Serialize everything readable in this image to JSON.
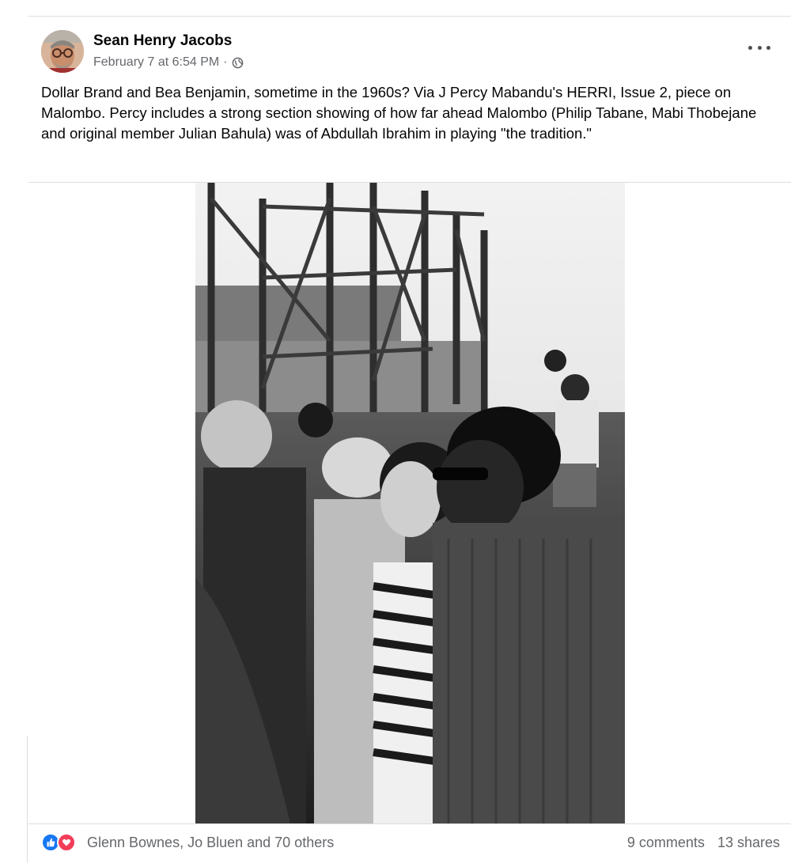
{
  "post": {
    "author": "Sean Henry Jacobs",
    "timestamp": "February 7 at 6:54 PM",
    "separator": "·",
    "privacy_icon": "globe-icon",
    "text": "Dollar Brand and Bea Benjamin, sometime in the 1960s? Via J Percy Mabandu's HERRI, Issue 2, piece on Malombo.  Percy includes a strong section showing of how far ahead Malombo (Philip Tabane, Mabi Thobejane and original member Julian Bahula) was of Abdullah Ibrahim in playing \"the tradition.\""
  },
  "footer": {
    "reactions_text": "Glenn Bownes, Jo Bluen and 70 others",
    "comments": "9 comments",
    "shares": "13 shares",
    "like_color": "#1877f2",
    "love_color": "#f33e58"
  },
  "icons": {
    "more": "more-options-icon",
    "like": "like-icon",
    "love": "love-icon"
  }
}
